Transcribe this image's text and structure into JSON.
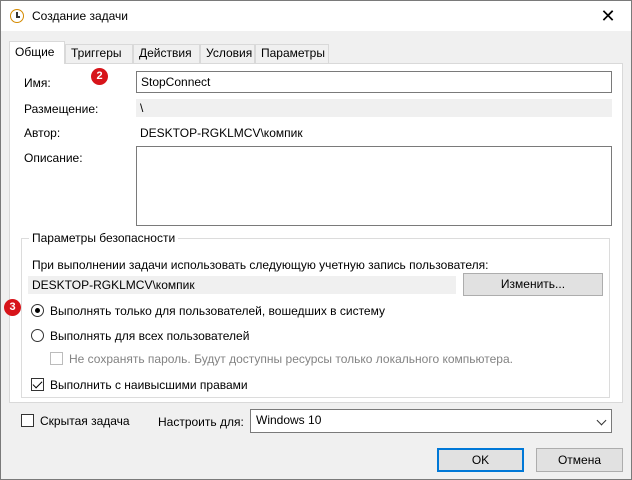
{
  "window": {
    "title": "Создание задачи",
    "close_glyph": "✕"
  },
  "tabs": [
    {
      "label": "Общие",
      "active": true
    },
    {
      "label": "Триггеры"
    },
    {
      "label": "Действия"
    },
    {
      "label": "Условия"
    },
    {
      "label": "Параметры"
    }
  ],
  "general": {
    "name_label": "Имя:",
    "name_value": "StopConnect",
    "location_label": "Размещение:",
    "location_value": "\\",
    "author_label": "Автор:",
    "author_value": "DESKTOP-RGKLMCV\\компик",
    "description_label": "Описание:",
    "description_value": ""
  },
  "badges": {
    "two": "2",
    "three": "3"
  },
  "security": {
    "title": "Параметры безопасности",
    "account_prompt": "При выполнении задачи использовать следующую учетную запись пользователя:",
    "account_value": "DESKTOP-RGKLMCV\\компик",
    "change_button": "Изменить...",
    "radio_logged_on": "Выполнять только для пользователей, вошедших в систему",
    "radio_all_users": "Выполнять для всех пользователей",
    "no_store_password": "Не сохранять пароль. Будут доступны ресурсы только локального компьютера.",
    "highest_privileges": "Выполнить с наивысшими правами"
  },
  "footer": {
    "hidden_task": "Скрытая задача",
    "configure_for_label": "Настроить для:",
    "configure_for_value": "Windows 10",
    "ok_button": "OK",
    "cancel_button": "Отмена"
  },
  "icons": {
    "app": "clock-icon",
    "close": "close-icon",
    "dropdown": "chevron-down-icon"
  },
  "colors": {
    "accent": "#0078d7",
    "badge": "#d7141a"
  }
}
